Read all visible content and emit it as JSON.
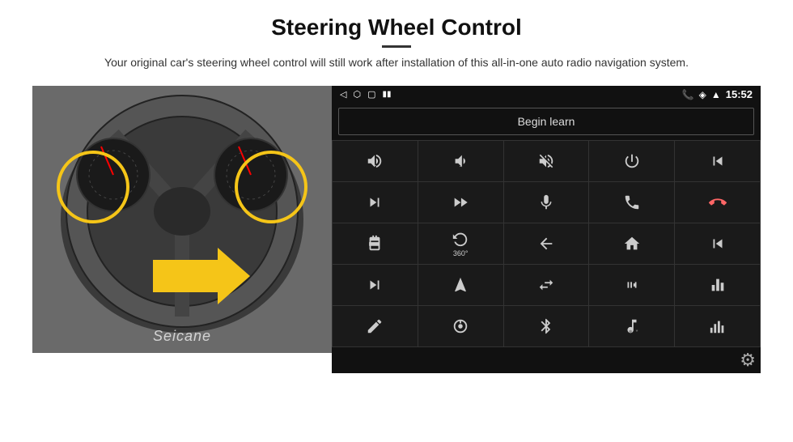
{
  "page": {
    "title": "Steering Wheel Control",
    "subtitle": "Your original car's steering wheel control will still work after installation of this all-in-one auto radio navigation system.",
    "divider": true
  },
  "status_bar": {
    "left_icons": [
      "back-icon",
      "home-icon",
      "square-icon",
      "signal-icon"
    ],
    "right_icons": [
      "phone-icon",
      "location-icon",
      "wifi-icon"
    ],
    "time": "15:52"
  },
  "begin_learn": {
    "label": "Begin learn"
  },
  "controls": [
    {
      "icon": "vol-up",
      "symbol": "🔊+"
    },
    {
      "icon": "vol-down",
      "symbol": "🔊-"
    },
    {
      "icon": "mute",
      "symbol": "🔇"
    },
    {
      "icon": "power",
      "symbol": "⏻"
    },
    {
      "icon": "prev-track",
      "symbol": "⏮"
    },
    {
      "icon": "next",
      "symbol": "⏭"
    },
    {
      "icon": "fast-forward",
      "symbol": "⏩"
    },
    {
      "icon": "mic",
      "symbol": "🎤"
    },
    {
      "icon": "phone",
      "symbol": "📞"
    },
    {
      "icon": "hang-up",
      "symbol": "📵"
    },
    {
      "icon": "phone-book",
      "symbol": "📖"
    },
    {
      "icon": "360",
      "symbol": "360°"
    },
    {
      "icon": "back",
      "symbol": "↩"
    },
    {
      "icon": "home",
      "symbol": "🏠"
    },
    {
      "icon": "skip-back",
      "symbol": "⏮"
    },
    {
      "icon": "skip",
      "symbol": "⏭"
    },
    {
      "icon": "nav",
      "symbol": "➤"
    },
    {
      "icon": "swap",
      "symbol": "⇄"
    },
    {
      "icon": "radio",
      "symbol": "📻"
    },
    {
      "icon": "eq",
      "symbol": "🎚"
    },
    {
      "icon": "pen",
      "symbol": "✏"
    },
    {
      "icon": "knob",
      "symbol": "🔘"
    },
    {
      "icon": "bluetooth",
      "symbol": "⚡"
    },
    {
      "icon": "music",
      "symbol": "🎵"
    },
    {
      "icon": "spectrum",
      "symbol": "📊"
    }
  ],
  "settings": {
    "gear_label": "⚙"
  },
  "branding": {
    "logo": "Seicane"
  }
}
